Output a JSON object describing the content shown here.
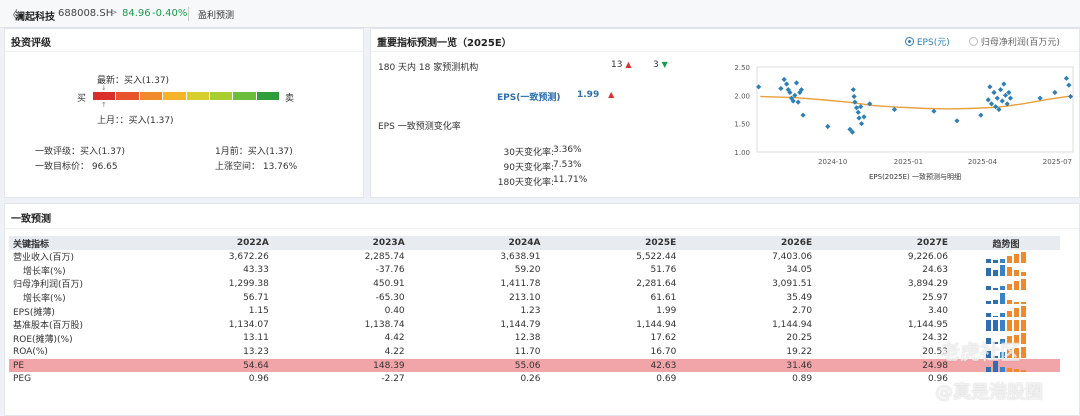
{
  "header": {
    "back": "〈",
    "name": "澜起科技",
    "code": "688008.SH",
    "arrow": ">",
    "price": "84.96",
    "change": "-0.40%",
    "tab": "盈利预测"
  },
  "rating": {
    "title": "投资评级",
    "latest": "最新：买入(1.37)",
    "prev": "上月：：买入(1.37)",
    "buy_label": "买",
    "sell_label": "卖",
    "consensus_rating": "一致评级：买入(1.37)",
    "consensus_target": "一致目标价：  96.65",
    "month_ago": "1月前：买入(1.37)",
    "upside": "上涨空间：  13.76%",
    "scale_colors": [
      "#d9302c",
      "#e8542c",
      "#f08a2c",
      "#f5b52a",
      "#d7cf2c",
      "#a8cf30",
      "#6cbd3a",
      "#2f9e3a"
    ]
  },
  "indicators": {
    "title": "重要指标预测一览（2025E）",
    "radio_eps": "EPS(元)",
    "radio_profit": "归母净利润(百万元)",
    "inst_label": "180 天内 18 家预测机构",
    "up_count": "13",
    "down_count": "3",
    "eps_label": "EPS(一致预测)",
    "eps_value": "1.99",
    "change_title": "EPS 一致预测变化率",
    "rows": [
      {
        "label": "30天变化率:",
        "value": "3.36%"
      },
      {
        "label": "90天变化率:",
        "value": "7.53%"
      },
      {
        "label": "180天变化率:",
        "value": "11.71%"
      }
    ]
  },
  "chart_data": {
    "type": "scatter",
    "title": "",
    "xlabel": "EPS(2025E) 一致预测与明细",
    "ylabel": "",
    "yticks": [
      "2.50",
      "2.00",
      "1.50",
      "1.00"
    ],
    "xticks": [
      "2024-10",
      "2025-01",
      "2025-04",
      "2025-07"
    ],
    "ylim": [
      1.0,
      2.5
    ],
    "xlim": [
      "2024-07-01",
      "2025-07-20"
    ],
    "series": [
      {
        "type": "line",
        "color": "#e8a03c",
        "points": [
          [
            "2024-07-05",
            1.98
          ],
          [
            "2024-08-15",
            1.96
          ],
          [
            "2024-09-20",
            1.92
          ],
          [
            "2024-10-20",
            1.88
          ],
          [
            "2024-11-20",
            1.82
          ],
          [
            "2024-12-20",
            1.79
          ],
          [
            "2025-01-20",
            1.77
          ],
          [
            "2025-02-20",
            1.76
          ],
          [
            "2025-03-20",
            1.77
          ],
          [
            "2025-04-20",
            1.79
          ],
          [
            "2025-05-20",
            1.85
          ],
          [
            "2025-06-20",
            1.93
          ],
          [
            "2025-07-18",
            1.99
          ]
        ]
      },
      {
        "type": "scatter",
        "color": "#2d7fb8",
        "points": [
          [
            "2024-07-03",
            2.15
          ],
          [
            "2024-07-30",
            2.12
          ],
          [
            "2024-08-03",
            2.28
          ],
          [
            "2024-08-06",
            2.2
          ],
          [
            "2024-08-08",
            2.1
          ],
          [
            "2024-08-10",
            2.05
          ],
          [
            "2024-08-12",
            1.95
          ],
          [
            "2024-08-14",
            1.9
          ],
          [
            "2024-08-16",
            2.0
          ],
          [
            "2024-08-18",
            2.22
          ],
          [
            "2024-08-20",
            1.88
          ],
          [
            "2024-08-22",
            2.05
          ],
          [
            "2024-08-24",
            2.1
          ],
          [
            "2024-08-26",
            1.65
          ],
          [
            "2024-09-25",
            1.45
          ],
          [
            "2024-10-22",
            1.4
          ],
          [
            "2024-10-25",
            1.35
          ],
          [
            "2024-10-26",
            2.1
          ],
          [
            "2024-10-27",
            1.98
          ],
          [
            "2024-10-28",
            1.88
          ],
          [
            "2024-10-30",
            1.78
          ],
          [
            "2024-11-01",
            1.7
          ],
          [
            "2024-11-02",
            1.6
          ],
          [
            "2024-11-04",
            1.8
          ],
          [
            "2024-11-05",
            1.5
          ],
          [
            "2024-11-08",
            1.62
          ],
          [
            "2024-11-15",
            1.85
          ],
          [
            "2024-12-15",
            1.75
          ],
          [
            "2025-02-01",
            1.72
          ],
          [
            "2025-03-01",
            1.55
          ],
          [
            "2025-03-30",
            1.65
          ],
          [
            "2025-04-08",
            1.92
          ],
          [
            "2025-04-10",
            2.15
          ],
          [
            "2025-04-12",
            1.85
          ],
          [
            "2025-04-15",
            2.05
          ],
          [
            "2025-04-17",
            1.8
          ],
          [
            "2025-04-19",
            1.95
          ],
          [
            "2025-04-21",
            1.75
          ],
          [
            "2025-04-23",
            2.1
          ],
          [
            "2025-04-25",
            1.9
          ],
          [
            "2025-04-27",
            2.2
          ],
          [
            "2025-04-29",
            2.0
          ],
          [
            "2025-05-01",
            1.85
          ],
          [
            "2025-05-03",
            2.05
          ],
          [
            "2025-05-05",
            1.95
          ],
          [
            "2025-06-10",
            1.95
          ],
          [
            "2025-06-28",
            2.05
          ],
          [
            "2025-07-12",
            2.3
          ],
          [
            "2025-07-15",
            2.18
          ],
          [
            "2025-07-17",
            1.98
          ]
        ]
      }
    ]
  },
  "forecast": {
    "title": "一致预测",
    "columns": [
      "关键指标",
      "2022A",
      "2023A",
      "2024A",
      "2025E",
      "2026E",
      "2027E",
      "趋势图"
    ],
    "rows": [
      {
        "label": "营业收入(百万)",
        "values": [
          "3,672.26",
          "2,285.74",
          "3,638.91",
          "5,522.44",
          "7,403.06",
          "9,226.06"
        ],
        "indent": false,
        "trend": [
          0.39,
          0.25,
          0.39,
          0.6,
          0.8,
          1.0
        ]
      },
      {
        "label": "增长率(%)",
        "values": [
          "43.33",
          "-37.76",
          "59.20",
          "51.76",
          "34.05",
          "24.63"
        ],
        "indent": true,
        "trend": [
          0.73,
          0.6,
          1.0,
          0.87,
          0.57,
          0.41
        ]
      },
      {
        "label": "归母净利润(百万)",
        "values": [
          "1,299.38",
          "450.91",
          "1,411.78",
          "2,281.64",
          "3,091.51",
          "3,894.29"
        ],
        "indent": false,
        "trend": [
          0.33,
          0.12,
          0.36,
          0.59,
          0.79,
          1.0
        ]
      },
      {
        "label": "增长率(%)",
        "values": [
          "56.71",
          "-65.30",
          "213.10",
          "61.61",
          "35.49",
          "25.97"
        ],
        "indent": true,
        "trend": [
          0.27,
          0.31,
          1.0,
          0.29,
          0.17,
          0.12
        ]
      },
      {
        "label": "EPS(摊薄)",
        "values": [
          "1.15",
          "0.40",
          "1.23",
          "1.99",
          "2.70",
          "3.40"
        ],
        "indent": false,
        "trend": [
          0.34,
          0.12,
          0.36,
          0.59,
          0.79,
          1.0
        ]
      },
      {
        "label": "基准股本(百万股)",
        "values": [
          "1,134.07",
          "1,138.74",
          "1,144.79",
          "1,144.94",
          "1,144.94",
          "1,144.95"
        ],
        "indent": false,
        "trend": [
          0.99,
          0.99,
          1.0,
          1.0,
          1.0,
          1.0
        ]
      },
      {
        "label": "ROE(摊薄)(%)",
        "values": [
          "13.11",
          "4.42",
          "12.38",
          "17.62",
          "20.25",
          "24.32"
        ],
        "indent": false,
        "trend": [
          0.54,
          0.18,
          0.51,
          0.72,
          0.83,
          1.0
        ]
      },
      {
        "label": "ROA(%)",
        "values": [
          "13.23",
          "4.22",
          "11.70",
          "16.70",
          "19.22",
          "20.53"
        ],
        "indent": false,
        "trend": [
          0.64,
          0.21,
          0.57,
          0.81,
          0.94,
          1.0
        ]
      },
      {
        "label": "PE",
        "values": [
          "54.64",
          "148.39",
          "55.06",
          "42.63",
          "31.46",
          "24.98"
        ],
        "indent": false,
        "highlight": true,
        "trend": [
          0.37,
          1.0,
          0.37,
          0.29,
          0.21,
          0.17
        ]
      },
      {
        "label": "PEG",
        "values": [
          "0.96",
          "-2.27",
          "0.26",
          "0.69",
          "0.89",
          "0.96"
        ],
        "indent": false,
        "trend": []
      }
    ]
  },
  "watermark": {
    "top": "老虎社区",
    "bottom": "@真是港股圈"
  }
}
